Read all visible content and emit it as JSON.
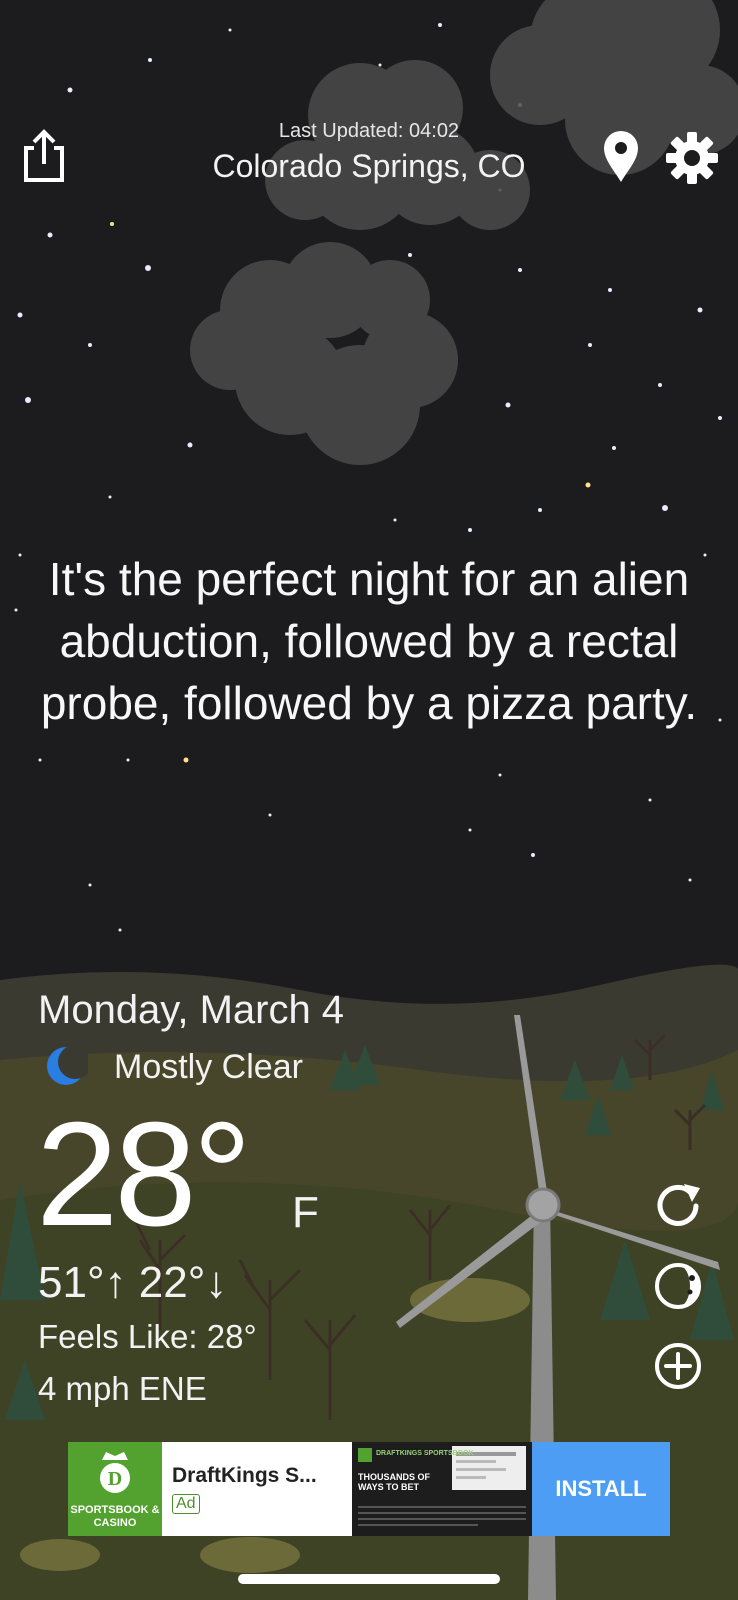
{
  "header": {
    "last_updated": "Last Updated: 04:02",
    "location": "Colorado Springs, CO",
    "share_icon": "share-icon",
    "location_icon": "location-pin-icon",
    "settings_icon": "gear-icon"
  },
  "message": "It's the perfect night for an alien abduction, followed by a rectal probe, followed by a pizza party.",
  "weather": {
    "date": "Monday, March 4",
    "condition": "Mostly Clear",
    "condition_icon": "moon-icon",
    "temperature": "28°",
    "unit": "F",
    "hi_lo": "51°↑ 22°↓",
    "feels_like": "Feels Like: 28°",
    "wind": "4 mph ENE"
  },
  "side_actions": [
    {
      "icon": "refresh-icon"
    },
    {
      "icon": "moon-phase-icon"
    },
    {
      "icon": "add-icon"
    }
  ],
  "ad": {
    "logo_text": "SPORTSBOOK & CASINO",
    "title": "DraftKings S...",
    "badge": "Ad",
    "image_brand": "DRAFTKINGS SPORTSBOOK",
    "image_headline": "THOUSANDS OF WAYS TO BET",
    "install_label": "INSTALL",
    "colors": {
      "logo_bg": "#53a12f",
      "install_bg": "#4d9df5"
    }
  },
  "colors": {
    "sky": "#1c1c1e",
    "ground": "#4a4a2a",
    "text": "#ffffff"
  }
}
